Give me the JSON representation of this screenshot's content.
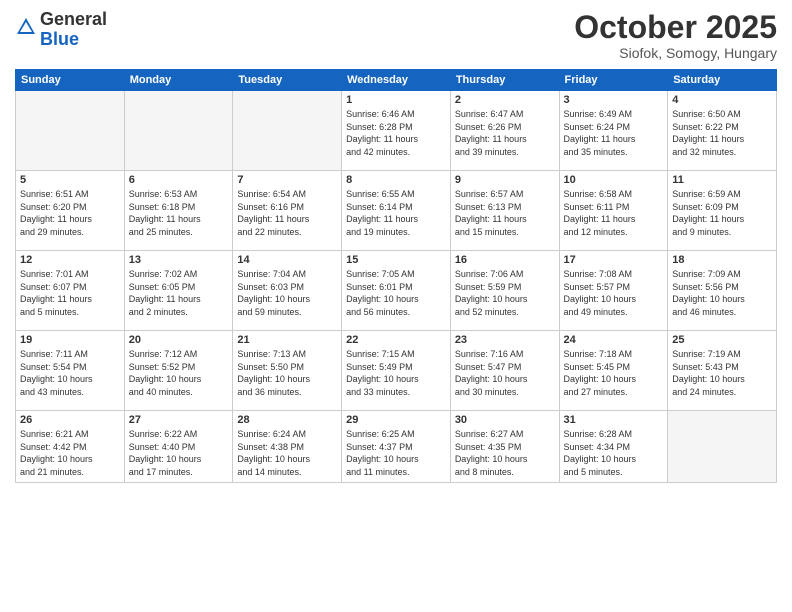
{
  "header": {
    "logo_general": "General",
    "logo_blue": "Blue",
    "month_title": "October 2025",
    "location": "Siofok, Somogy, Hungary"
  },
  "weekdays": [
    "Sunday",
    "Monday",
    "Tuesday",
    "Wednesday",
    "Thursday",
    "Friday",
    "Saturday"
  ],
  "weeks": [
    [
      {
        "day": "",
        "info": ""
      },
      {
        "day": "",
        "info": ""
      },
      {
        "day": "",
        "info": ""
      },
      {
        "day": "1",
        "info": "Sunrise: 6:46 AM\nSunset: 6:28 PM\nDaylight: 11 hours\nand 42 minutes."
      },
      {
        "day": "2",
        "info": "Sunrise: 6:47 AM\nSunset: 6:26 PM\nDaylight: 11 hours\nand 39 minutes."
      },
      {
        "day": "3",
        "info": "Sunrise: 6:49 AM\nSunset: 6:24 PM\nDaylight: 11 hours\nand 35 minutes."
      },
      {
        "day": "4",
        "info": "Sunrise: 6:50 AM\nSunset: 6:22 PM\nDaylight: 11 hours\nand 32 minutes."
      }
    ],
    [
      {
        "day": "5",
        "info": "Sunrise: 6:51 AM\nSunset: 6:20 PM\nDaylight: 11 hours\nand 29 minutes."
      },
      {
        "day": "6",
        "info": "Sunrise: 6:53 AM\nSunset: 6:18 PM\nDaylight: 11 hours\nand 25 minutes."
      },
      {
        "day": "7",
        "info": "Sunrise: 6:54 AM\nSunset: 6:16 PM\nDaylight: 11 hours\nand 22 minutes."
      },
      {
        "day": "8",
        "info": "Sunrise: 6:55 AM\nSunset: 6:14 PM\nDaylight: 11 hours\nand 19 minutes."
      },
      {
        "day": "9",
        "info": "Sunrise: 6:57 AM\nSunset: 6:13 PM\nDaylight: 11 hours\nand 15 minutes."
      },
      {
        "day": "10",
        "info": "Sunrise: 6:58 AM\nSunset: 6:11 PM\nDaylight: 11 hours\nand 12 minutes."
      },
      {
        "day": "11",
        "info": "Sunrise: 6:59 AM\nSunset: 6:09 PM\nDaylight: 11 hours\nand 9 minutes."
      }
    ],
    [
      {
        "day": "12",
        "info": "Sunrise: 7:01 AM\nSunset: 6:07 PM\nDaylight: 11 hours\nand 5 minutes."
      },
      {
        "day": "13",
        "info": "Sunrise: 7:02 AM\nSunset: 6:05 PM\nDaylight: 11 hours\nand 2 minutes."
      },
      {
        "day": "14",
        "info": "Sunrise: 7:04 AM\nSunset: 6:03 PM\nDaylight: 10 hours\nand 59 minutes."
      },
      {
        "day": "15",
        "info": "Sunrise: 7:05 AM\nSunset: 6:01 PM\nDaylight: 10 hours\nand 56 minutes."
      },
      {
        "day": "16",
        "info": "Sunrise: 7:06 AM\nSunset: 5:59 PM\nDaylight: 10 hours\nand 52 minutes."
      },
      {
        "day": "17",
        "info": "Sunrise: 7:08 AM\nSunset: 5:57 PM\nDaylight: 10 hours\nand 49 minutes."
      },
      {
        "day": "18",
        "info": "Sunrise: 7:09 AM\nSunset: 5:56 PM\nDaylight: 10 hours\nand 46 minutes."
      }
    ],
    [
      {
        "day": "19",
        "info": "Sunrise: 7:11 AM\nSunset: 5:54 PM\nDaylight: 10 hours\nand 43 minutes."
      },
      {
        "day": "20",
        "info": "Sunrise: 7:12 AM\nSunset: 5:52 PM\nDaylight: 10 hours\nand 40 minutes."
      },
      {
        "day": "21",
        "info": "Sunrise: 7:13 AM\nSunset: 5:50 PM\nDaylight: 10 hours\nand 36 minutes."
      },
      {
        "day": "22",
        "info": "Sunrise: 7:15 AM\nSunset: 5:49 PM\nDaylight: 10 hours\nand 33 minutes."
      },
      {
        "day": "23",
        "info": "Sunrise: 7:16 AM\nSunset: 5:47 PM\nDaylight: 10 hours\nand 30 minutes."
      },
      {
        "day": "24",
        "info": "Sunrise: 7:18 AM\nSunset: 5:45 PM\nDaylight: 10 hours\nand 27 minutes."
      },
      {
        "day": "25",
        "info": "Sunrise: 7:19 AM\nSunset: 5:43 PM\nDaylight: 10 hours\nand 24 minutes."
      }
    ],
    [
      {
        "day": "26",
        "info": "Sunrise: 6:21 AM\nSunset: 4:42 PM\nDaylight: 10 hours\nand 21 minutes."
      },
      {
        "day": "27",
        "info": "Sunrise: 6:22 AM\nSunset: 4:40 PM\nDaylight: 10 hours\nand 17 minutes."
      },
      {
        "day": "28",
        "info": "Sunrise: 6:24 AM\nSunset: 4:38 PM\nDaylight: 10 hours\nand 14 minutes."
      },
      {
        "day": "29",
        "info": "Sunrise: 6:25 AM\nSunset: 4:37 PM\nDaylight: 10 hours\nand 11 minutes."
      },
      {
        "day": "30",
        "info": "Sunrise: 6:27 AM\nSunset: 4:35 PM\nDaylight: 10 hours\nand 8 minutes."
      },
      {
        "day": "31",
        "info": "Sunrise: 6:28 AM\nSunset: 4:34 PM\nDaylight: 10 hours\nand 5 minutes."
      },
      {
        "day": "",
        "info": ""
      }
    ]
  ]
}
